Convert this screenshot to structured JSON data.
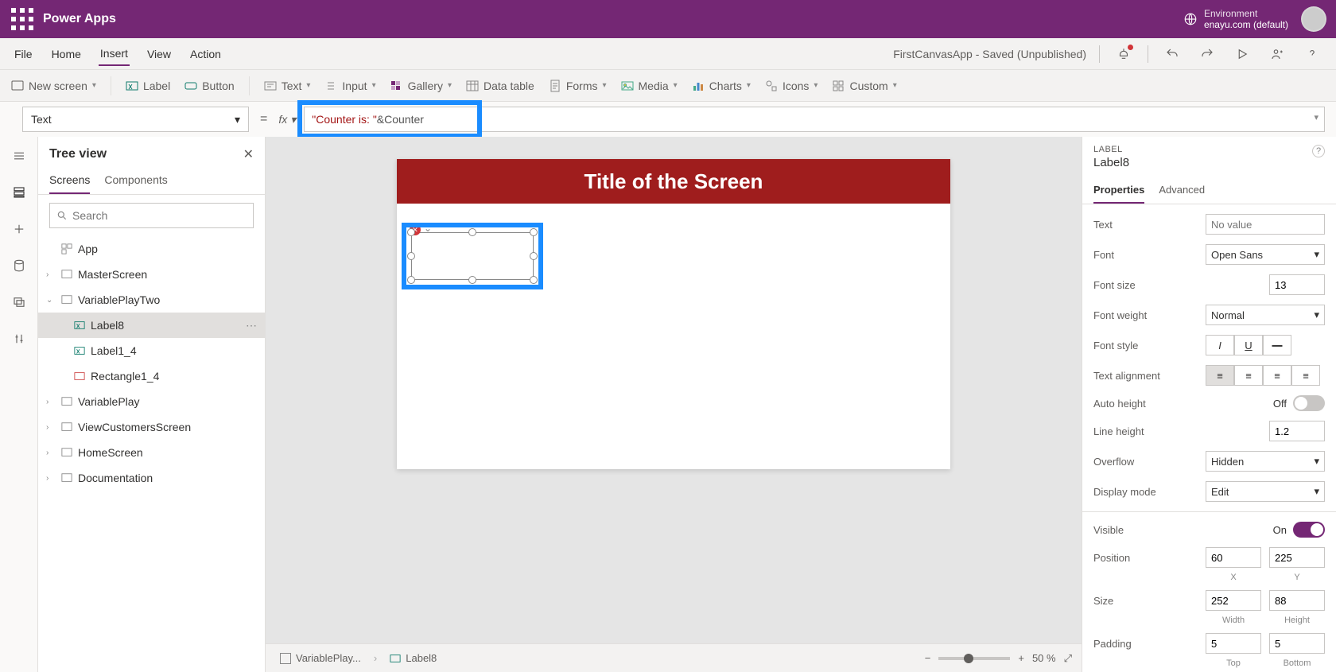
{
  "titlebar": {
    "brand": "Power Apps",
    "env_label": "Environment",
    "env_value": "enayu.com (default)"
  },
  "menubar": {
    "items": [
      "File",
      "Home",
      "Insert",
      "View",
      "Action"
    ],
    "active": "Insert",
    "status": "FirstCanvasApp - Saved (Unpublished)"
  },
  "ribbon": {
    "new_screen": "New screen",
    "label": "Label",
    "button": "Button",
    "text": "Text",
    "input": "Input",
    "gallery": "Gallery",
    "data_table": "Data table",
    "forms": "Forms",
    "media": "Media",
    "charts": "Charts",
    "icons": "Icons",
    "custom": "Custom"
  },
  "formula": {
    "property": "Text",
    "value_display": "\"Counter is: \" & Counter",
    "value_string": "\"Counter is: \"",
    "value_op": " & ",
    "value_ident": "Counter"
  },
  "tree": {
    "title": "Tree view",
    "tabs": [
      "Screens",
      "Components"
    ],
    "active_tab": "Screens",
    "search_placeholder": "Search",
    "app_label": "App",
    "items": [
      {
        "label": "MasterScreen"
      },
      {
        "label": "VariablePlayTwo",
        "expanded": true,
        "children": [
          {
            "label": "Label8",
            "selected": true,
            "kind": "label"
          },
          {
            "label": "Label1_4",
            "kind": "label"
          },
          {
            "label": "Rectangle1_4",
            "kind": "rect"
          }
        ]
      },
      {
        "label": "VariablePlay"
      },
      {
        "label": "ViewCustomersScreen"
      },
      {
        "label": "HomeScreen"
      },
      {
        "label": "Documentation"
      }
    ]
  },
  "canvas": {
    "title": "Title of the Screen",
    "breadcrumb": [
      "VariablePlay...",
      "Label8"
    ],
    "zoom": "50 %"
  },
  "props": {
    "kind": "LABEL",
    "name": "Label8",
    "tabs": [
      "Properties",
      "Advanced"
    ],
    "active_tab": "Properties",
    "text_label": "Text",
    "text_placeholder": "No value",
    "font_label": "Font",
    "font_value": "Open Sans",
    "fontsize_label": "Font size",
    "fontsize_value": "13",
    "fontweight_label": "Font weight",
    "fontweight_value": "Normal",
    "fontstyle_label": "Font style",
    "align_label": "Text alignment",
    "autoheight_label": "Auto height",
    "autoheight_value": "Off",
    "lineheight_label": "Line height",
    "lineheight_value": "1.2",
    "overflow_label": "Overflow",
    "overflow_value": "Hidden",
    "displaymode_label": "Display mode",
    "displaymode_value": "Edit",
    "visible_label": "Visible",
    "visible_value": "On",
    "position_label": "Position",
    "position_x": "60",
    "position_y": "225",
    "xy_labels": [
      "X",
      "Y"
    ],
    "size_label": "Size",
    "size_w": "252",
    "size_h": "88",
    "wh_labels": [
      "Width",
      "Height"
    ],
    "padding_label": "Padding",
    "padding_t": "5",
    "padding_b": "5",
    "pad_labels": [
      "Top",
      "Bottom"
    ]
  }
}
